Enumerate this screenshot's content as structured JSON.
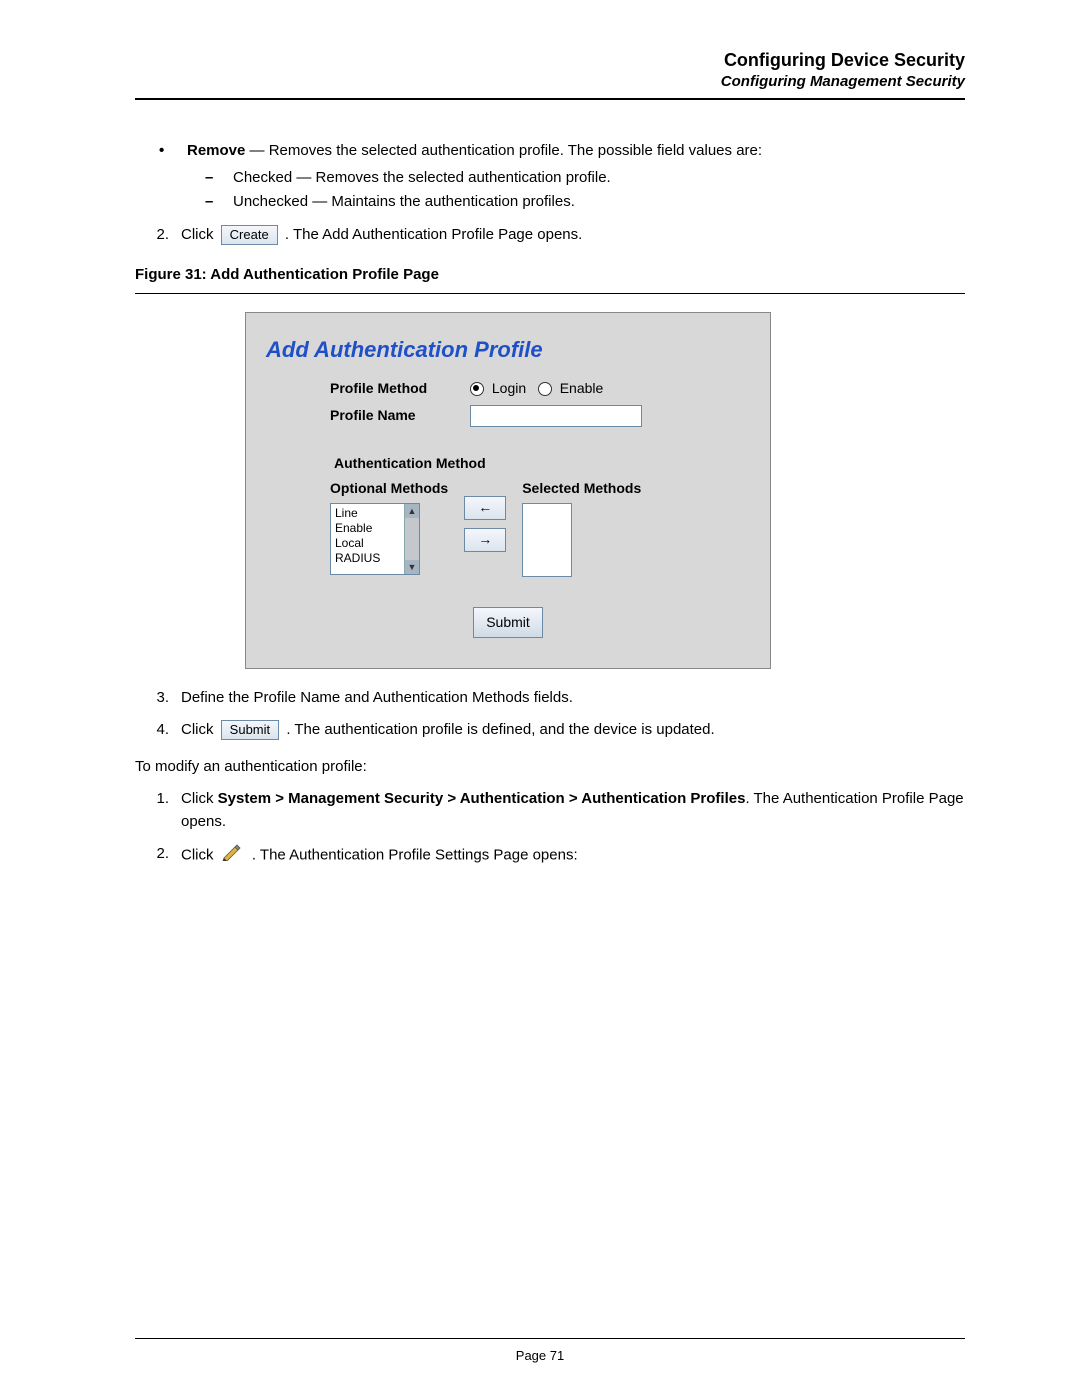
{
  "header": {
    "title": "Configuring Device Security",
    "subtitle": "Configuring Management Security"
  },
  "bullet": {
    "remove_label": "Remove",
    "remove_desc": " — Removes the selected authentication profile. The possible field values are:",
    "checked": "Checked — Removes the selected authentication profile.",
    "unchecked": "Unchecked — Maintains the authentication profiles."
  },
  "step2": {
    "num": "2.",
    "click": "Click ",
    "btn": "Create",
    "after": ". The Add Authentication Profile Page opens."
  },
  "figure": {
    "caption": "Figure 31:  Add Authentication Profile Page",
    "dlg_title": "Add Authentication Profile",
    "profile_method_label": "Profile Method",
    "radio_login": "Login",
    "radio_enable": "Enable",
    "profile_name_label": "Profile Name",
    "auth_method_label": "Authentication Method",
    "optional_label": "Optional Methods",
    "selected_label": "Selected Methods",
    "options": [
      "Line",
      "Enable",
      "Local",
      "RADIUS"
    ],
    "move_left": "←",
    "move_right": "→",
    "submit": "Submit"
  },
  "step3": {
    "num": "3.",
    "text": "Define the Profile Name and Authentication Methods fields."
  },
  "step4": {
    "num": "4.",
    "click": "Click ",
    "btn": "Submit",
    "after": ". The authentication profile is defined, and the device is updated."
  },
  "modify_intro": "To modify an authentication profile:",
  "mod1": {
    "num": "1.",
    "pre": "Click ",
    "path": "System > Management Security > Authentication > Authentication Profiles",
    "after": ". The Authentication Profile Page opens."
  },
  "mod2": {
    "num": "2.",
    "pre": "Click ",
    "after": ". The Authentication Profile Settings Page opens:"
  },
  "footer": {
    "page": "Page 71"
  }
}
